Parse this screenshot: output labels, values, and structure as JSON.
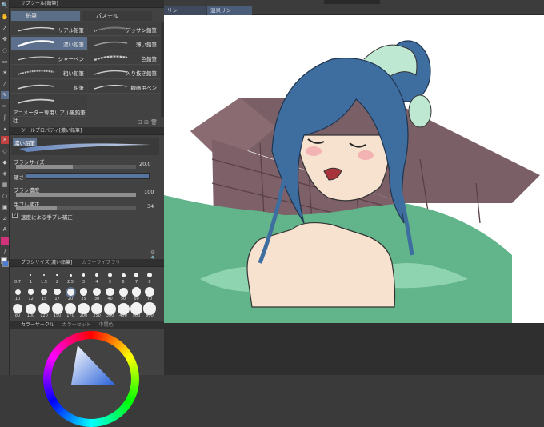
{
  "subtool": {
    "header": "サブツール[鉛筆]",
    "tab_pencil": "鉛筆",
    "tab_pastel": "パステル"
  },
  "brushes_left": [
    "リアル鉛筆",
    "濃い鉛筆",
    "シャーペン",
    "粗い鉛筆",
    "鉛筆",
    "アニメーター専用リアル風鉛筆 社"
  ],
  "brushes_right": [
    "デッサン鉛筆",
    "薄い鉛筆",
    "色鉛筆",
    "入り抜き鉛筆",
    "線画用ペン"
  ],
  "toolprop": {
    "header": "ツールプロパティ[濃い鉛筆]",
    "preview_name": "濃い鉛筆",
    "brush_size_label": "ブラシサイズ",
    "brush_size_value": "20.0",
    "hardness_label": "硬さ",
    "density_label": "ブラシ濃度",
    "density_value": "100",
    "stabilization_label": "手ブレ補正",
    "stabilization_value": "34",
    "speed_stab_label": "速度による手ブレ補正",
    "speed_stab_checked": true,
    "brush_size_fraction": 0.47,
    "density_fraction": 1.0,
    "stabilization_fraction": 0.34
  },
  "brushsize_panel": {
    "header": "ブラシサイズ[濃い鉛筆]",
    "tab2": "カラーライブラリ",
    "sizes_row1": [
      "0.7",
      "1",
      "1.5",
      "2",
      "2.5",
      "3",
      "4",
      "5",
      "6",
      "7",
      "8"
    ],
    "sizes_row2": [
      "10",
      "12",
      "15",
      "17",
      "20",
      "25",
      "30",
      "40",
      "50",
      "60",
      "70"
    ],
    "sizes_row3": [
      "80",
      "100",
      "120",
      "150",
      "170",
      "200",
      "250",
      "300",
      "400",
      "500",
      "600"
    ]
  },
  "colorcircle": {
    "header": "カラーサークル",
    "tab2": "カラーセット",
    "tab3": "中間色"
  },
  "document_tabs": [
    "リン",
    "温泉リン"
  ],
  "colors": {
    "accent": "#5c6f8c",
    "water": "#62b48a",
    "hair": "#3e6ea0",
    "wall": "#7b5f66",
    "skin": "#f7e2cf"
  }
}
